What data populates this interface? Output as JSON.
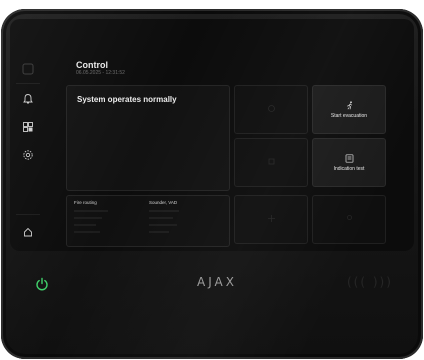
{
  "header": {
    "title": "Control",
    "date": "06.05.2025 - 12:31:52"
  },
  "sidebar": {
    "items": [
      {
        "icon": "notifications-bell-icon"
      },
      {
        "icon": "devices-grid-icon"
      },
      {
        "icon": "settings-gear-icon"
      },
      {
        "icon": "lock-icon"
      }
    ]
  },
  "status": {
    "text": "System operates normally"
  },
  "info": {
    "left_title": "Fire routing",
    "right_title": "Sounder, VAD"
  },
  "tiles": [
    {
      "label": "Start evacuation",
      "icon": "running-person-icon"
    },
    {
      "label": "Indication test",
      "icon": "indication-test-icon"
    }
  ],
  "device": {
    "logo": "AJAX",
    "reader_symbol": "((( )))",
    "power_color": "#3fd16a"
  }
}
